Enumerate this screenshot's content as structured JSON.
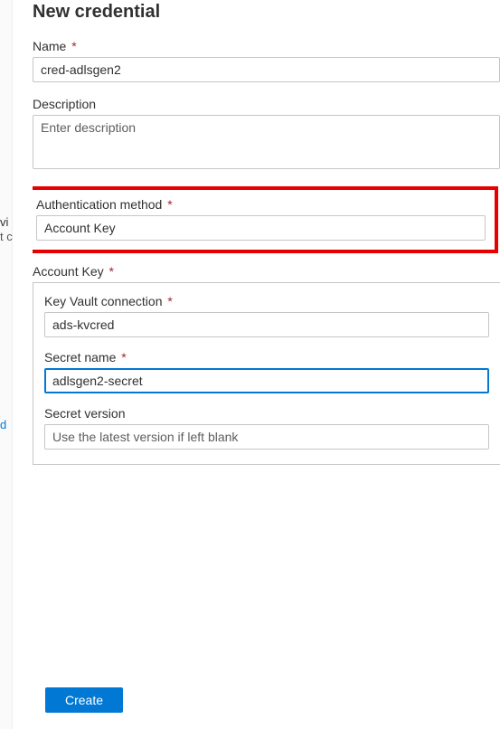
{
  "title": "New credential",
  "leftFragments": {
    "f1": "vi",
    "f2": "t c",
    "f3": "d"
  },
  "fields": {
    "name": {
      "label": "Name",
      "required": true,
      "value": "cred-adlsgen2"
    },
    "description": {
      "label": "Description",
      "required": false,
      "placeholder": "Enter description",
      "value": ""
    },
    "authMethod": {
      "label": "Authentication method",
      "required": true,
      "value": "Account Key"
    }
  },
  "accountKeySection": {
    "title": "Account Key",
    "required": true,
    "kvConnection": {
      "label": "Key Vault connection",
      "required": true,
      "value": "ads-kvcred"
    },
    "secretName": {
      "label": "Secret name",
      "required": true,
      "value": "adlsgen2-secret"
    },
    "secretVersion": {
      "label": "Secret version",
      "required": false,
      "placeholder": "Use the latest version if left blank",
      "value": ""
    }
  },
  "buttons": {
    "create": "Create"
  },
  "requiredMark": "*"
}
